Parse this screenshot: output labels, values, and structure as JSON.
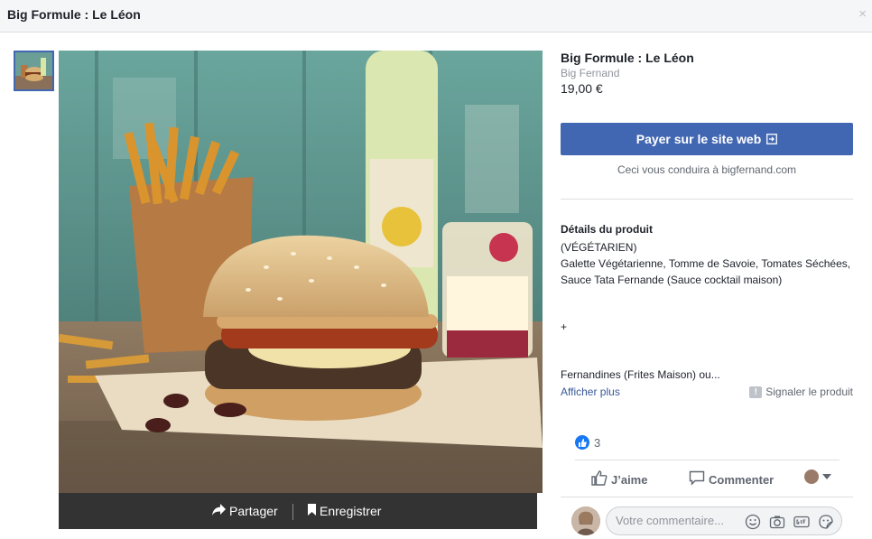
{
  "window": {
    "title": "Big Formule : Le Léon",
    "close_icon": "×"
  },
  "photo_actions": {
    "share": "Partager",
    "save": "Enregistrer"
  },
  "product": {
    "title": "Big Formule : Le Léon",
    "seller": "Big Fernand",
    "price": "19,00 €",
    "pay_button": "Payer sur le site web",
    "pay_note": "Ceci vous conduira à bigfernand.com",
    "details_heading": "Détails du produit",
    "details_line1": "(VÉGÉTARIEN)",
    "details_line2": "Galette Végétarienne, Tomme de Savoie, Tomates Séchées, Sauce Tata Fernande (Sauce cocktail maison)",
    "plus": "+",
    "details_line3": "Fernandines (Frites Maison) ou...",
    "show_more": "Afficher plus",
    "report": "Signaler le produit"
  },
  "reactions": {
    "like_count": "3",
    "like_label": "J’aime",
    "comment_label": "Commenter"
  },
  "comment": {
    "placeholder": "Votre commentaire..."
  },
  "colors": {
    "accent": "#4267b2",
    "link": "#385898",
    "like_blue": "#1877f2",
    "bar": "#333333"
  }
}
